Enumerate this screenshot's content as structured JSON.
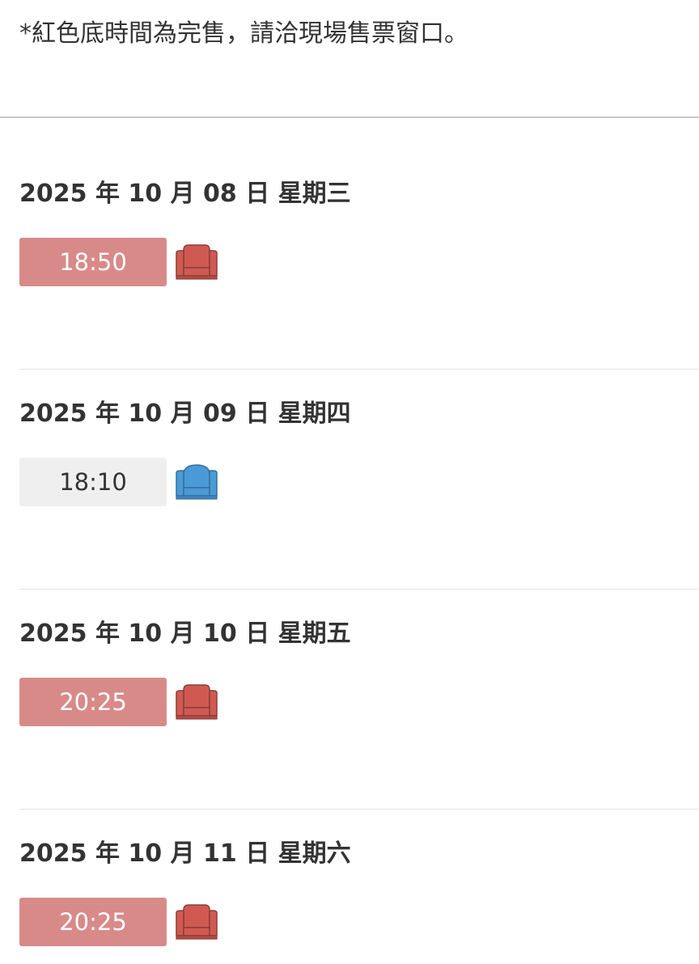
{
  "notice": "*紅色底時間為完售，請洽現場售票窗口。",
  "days": [
    {
      "date": "2025 年 10 月 08 日 星期三",
      "showtimes": [
        {
          "time": "18:50",
          "status": "soldout",
          "seat_icon": "seat-soldout-icon"
        }
      ]
    },
    {
      "date": "2025 年 10 月 09 日 星期四",
      "showtimes": [
        {
          "time": "18:10",
          "status": "available",
          "seat_icon": "seat-available-icon"
        }
      ]
    },
    {
      "date": "2025 年 10 月 10 日 星期五",
      "showtimes": [
        {
          "time": "20:25",
          "status": "soldout",
          "seat_icon": "seat-soldout-icon"
        }
      ]
    },
    {
      "date": "2025 年 10 月 11 日 星期六",
      "showtimes": [
        {
          "time": "20:25",
          "status": "soldout",
          "seat_icon": "seat-soldout-icon"
        }
      ]
    }
  ],
  "colors": {
    "soldout_button": "#d88a89",
    "available_button": "#efefef",
    "seat_soldout": "#d05a52",
    "seat_available": "#4a9ad8"
  }
}
